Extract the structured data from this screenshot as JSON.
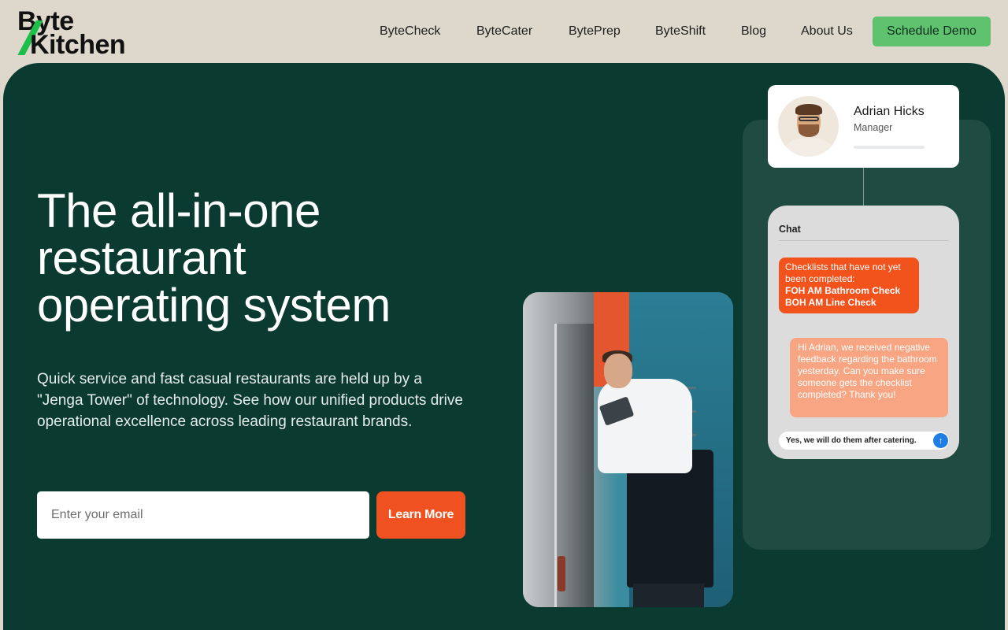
{
  "brand": {
    "line1": "Byte",
    "line2": "Kitchen"
  },
  "nav": {
    "links": [
      "ByteCheck",
      "ByteCater",
      "BytePrep",
      "ByteShift",
      "Blog",
      "About Us"
    ],
    "cta": "Schedule Demo"
  },
  "hero": {
    "headline_1": "The all-in-one",
    "headline_2": "restaurant",
    "headline_3": "operating system",
    "subtext": "Quick service and fast casual restaurants are held up by a \"Jenga Tower\" of technology. See how our unified products drive operational excellence across leading restaurant brands.",
    "email_placeholder": "Enter your email",
    "button": "Learn More"
  },
  "profile": {
    "name": "Adrian Hicks",
    "role": "Manager"
  },
  "chat": {
    "title": "Chat",
    "message_1_intro": "Checklists that have not yet been completed:",
    "message_1_item_1": "FOH AM Bathroom Check",
    "message_1_item_2": "BOH AM Line Check",
    "message_2": "Hi Adrian, we received negative feedback regarding the bathroom yesterday. Can you make sure someone gets the checklist completed? Thank you!",
    "reply": "Yes, we will do them after catering."
  },
  "colors": {
    "page_bg": "#ddd8cb",
    "hero_bg": "#0b3a31",
    "cta_green": "#5fc26f",
    "accent_orange": "#ef5121",
    "logo_green": "#1dbf4a"
  },
  "icons": {
    "send": "arrow-up-icon"
  }
}
